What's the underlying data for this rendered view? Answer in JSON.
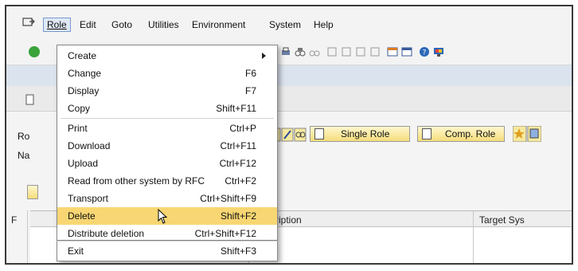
{
  "menubar": {
    "items": [
      {
        "label": "Role",
        "name": "menu-role"
      },
      {
        "label": "Edit",
        "name": "menu-edit"
      },
      {
        "label": "Goto",
        "name": "menu-goto"
      },
      {
        "label": "Utilities",
        "name": "menu-utilities"
      },
      {
        "label": "Environment",
        "name": "menu-environment"
      },
      {
        "label": "System",
        "name": "menu-system"
      },
      {
        "label": "Help",
        "name": "menu-help"
      }
    ]
  },
  "dropdown": {
    "items": [
      {
        "label": "Create",
        "shortcut": ""
      },
      {
        "label": "Change",
        "shortcut": "F6"
      },
      {
        "label": "Display",
        "shortcut": "F7"
      },
      {
        "label": "Copy",
        "shortcut": "Shift+F11"
      },
      {
        "label": "Print",
        "shortcut": "Ctrl+P"
      },
      {
        "label": "Download",
        "shortcut": "Ctrl+F11"
      },
      {
        "label": "Upload",
        "shortcut": "Ctrl+F12"
      },
      {
        "label": "Read from other system by RFC",
        "shortcut": "Ctrl+F2"
      },
      {
        "label": "Transport",
        "shortcut": "Ctrl+Shift+F9"
      },
      {
        "label": "Delete",
        "shortcut": "Shift+F2"
      },
      {
        "label": "Distribute deletion",
        "shortcut": "Ctrl+Shift+F12"
      },
      {
        "label": "Exit",
        "shortcut": "Shift+F3"
      }
    ]
  },
  "form": {
    "role_label": "Ro",
    "name_label": "Na",
    "single_role_label": "Single Role",
    "comp_role_label": "Comp. Role"
  },
  "table": {
    "col_first": "F",
    "col_description": "cription",
    "col_target": "Target Sys"
  }
}
